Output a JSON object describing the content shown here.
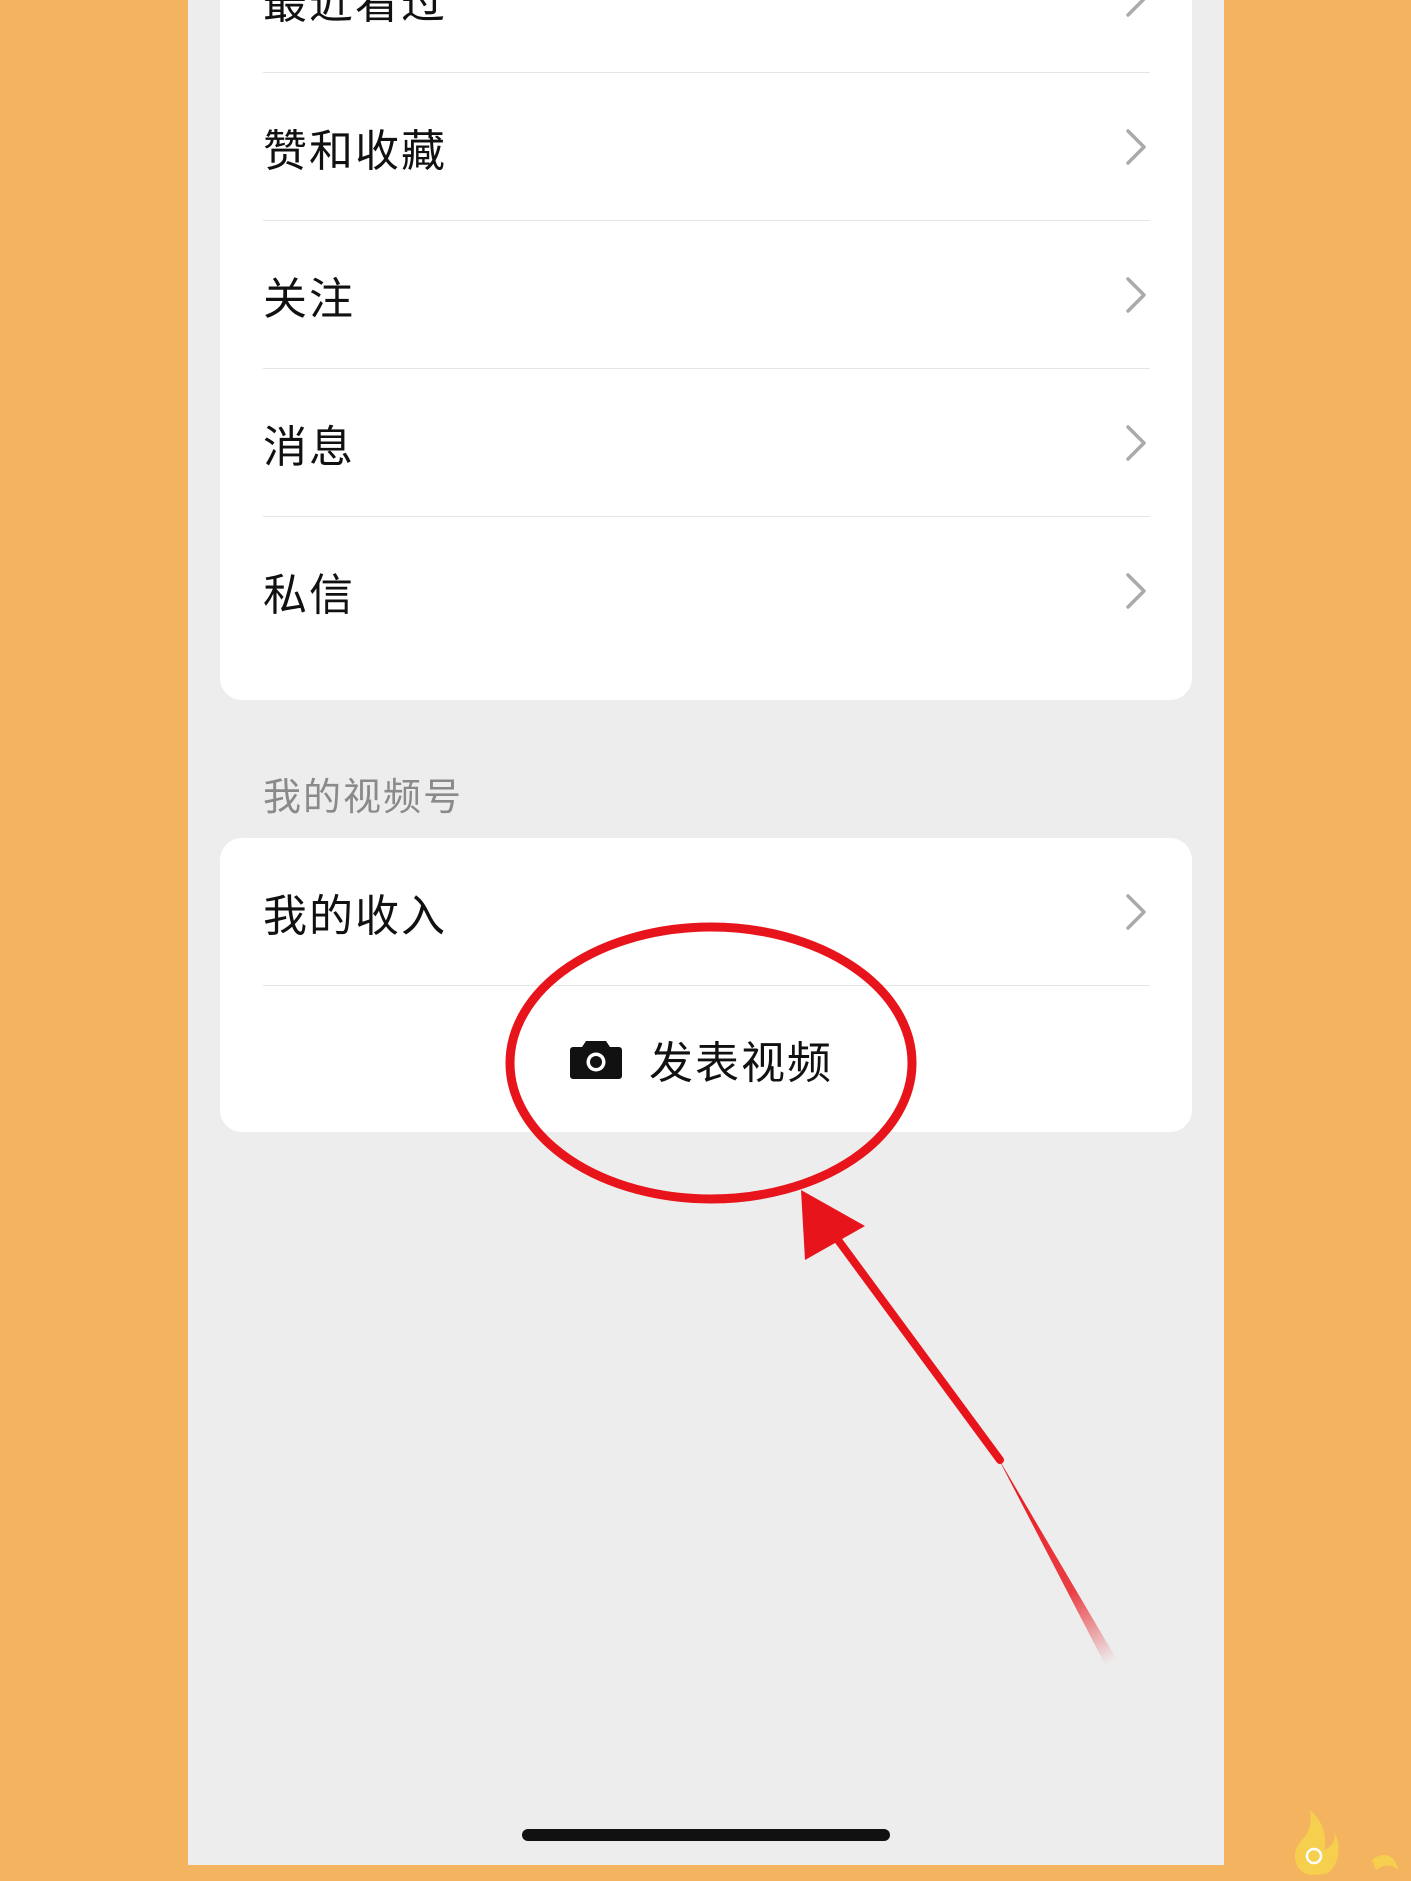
{
  "menu": {
    "items": [
      {
        "label": "最近看过"
      },
      {
        "label": "赞和收藏"
      },
      {
        "label": "关注"
      },
      {
        "label": "消息"
      },
      {
        "label": "私信"
      }
    ]
  },
  "channels": {
    "section_title": "我的视频号",
    "income_label": "我的收入",
    "publish_label": "发表视频",
    "publish_icon": "camera-icon"
  },
  "annotation": {
    "color": "#E8141B",
    "shapes": [
      "highlight-circle",
      "pointer-arrow"
    ]
  },
  "colors": {
    "page_background": "#F4B35F",
    "app_background": "#EDEDED",
    "card": "#FFFFFF"
  }
}
